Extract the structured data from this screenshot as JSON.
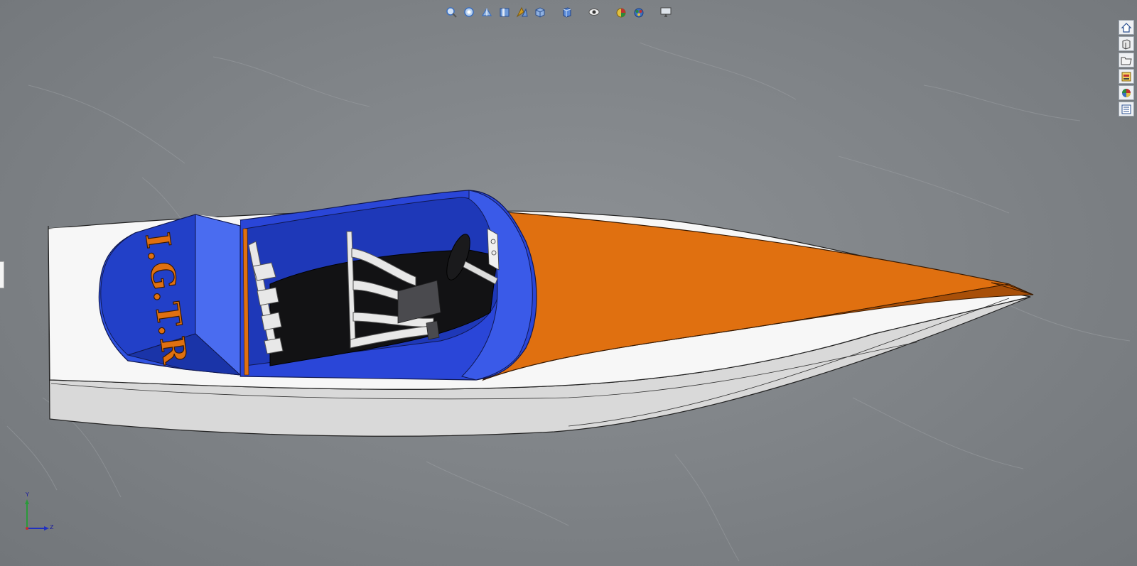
{
  "model": {
    "boat_name": "I.G.T.R"
  },
  "headsup_toolbar": {
    "items": [
      {
        "name": "zoom-to-fit-icon",
        "color": "#3a6fc0"
      },
      {
        "name": "zoom-to-area-icon",
        "color": "#3a6fc0"
      },
      {
        "name": "previous-view-icon",
        "color": "#3a6fc0"
      },
      {
        "name": "section-view-icon",
        "color": "#3a6fc0"
      },
      {
        "name": "dynamic-annotation-icon",
        "color": "#d09a20"
      },
      {
        "name": "view-orientation-icon",
        "color": "#3a6fc0"
      },
      {
        "name": "display-style-icon",
        "color": "#3a6fc0"
      },
      {
        "name": "hide-show-items-icon",
        "color": "#555555"
      },
      {
        "name": "edit-appearance-icon",
        "color": "#c03030"
      },
      {
        "name": "apply-scene-icon",
        "color": "#2a8a3a"
      },
      {
        "name": "view-settings-icon",
        "color": "#444444"
      }
    ]
  },
  "task_pane": {
    "items": [
      "home-icon",
      "design-library-icon",
      "file-explorer-icon",
      "view-palette-icon",
      "appearances-icon",
      "custom-properties-icon"
    ]
  },
  "triad": {
    "y_label": "Y",
    "z_label": "Z"
  },
  "colors": {
    "hull_white": "#f2f2f2",
    "cockpit_blue": "#1f3fd0",
    "deck_orange": "#e07010",
    "background": "#7e8286"
  }
}
